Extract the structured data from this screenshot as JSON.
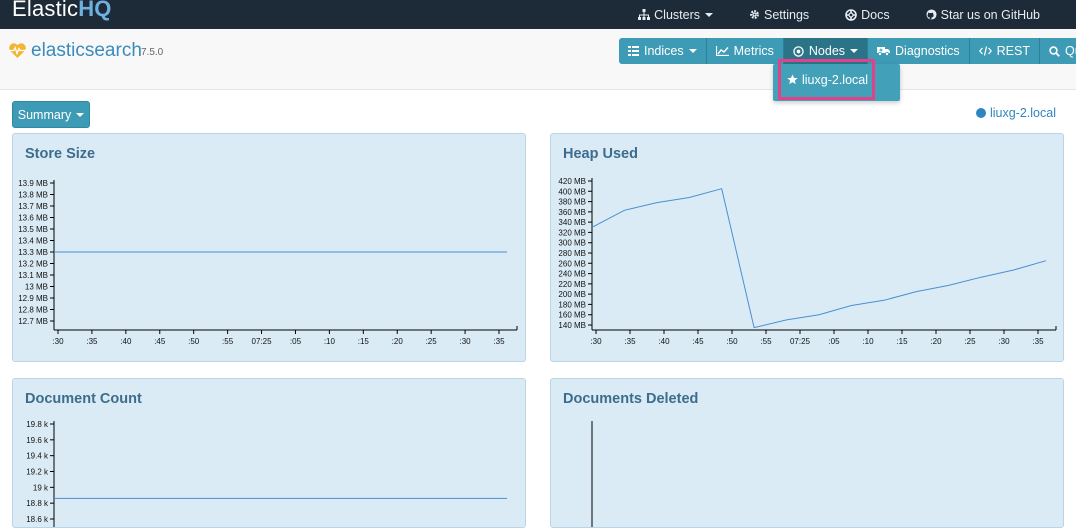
{
  "topbar": {
    "brand_main": "Elastic",
    "brand_accent": "HQ",
    "items": [
      {
        "label": "Clusters",
        "icon": "sitemap-icon",
        "dropdown": true
      },
      {
        "label": "Settings",
        "icon": "gear-icon",
        "dropdown": false
      },
      {
        "label": "Docs",
        "icon": "lifebuoy-icon",
        "dropdown": false
      },
      {
        "label": "Star us on GitHub",
        "icon": "github-icon",
        "dropdown": false
      }
    ]
  },
  "header": {
    "cluster_name": "elasticsearch",
    "version": "7.5.0",
    "buttons": [
      {
        "label": "Indices",
        "icon": "table-icon",
        "dropdown": true
      },
      {
        "label": "Metrics",
        "icon": "line-chart-icon",
        "dropdown": false
      },
      {
        "label": "Nodes",
        "icon": "target-icon",
        "dropdown": true
      },
      {
        "label": "Diagnostics",
        "icon": "ambulance-icon",
        "dropdown": false
      },
      {
        "label": "REST",
        "icon": "code-icon",
        "dropdown": false
      },
      {
        "label": "Query",
        "icon": "search-icon",
        "dropdown": false
      }
    ],
    "nodes_dropdown": [
      {
        "label": "liuxg-2.local",
        "icon": "star-icon"
      }
    ]
  },
  "summary": {
    "label": "Summary"
  },
  "node_status": {
    "label": "liuxg-2.local"
  },
  "colors": {
    "navbar": "#1d2a37",
    "button": "#3e9bb5",
    "panel": "#dbebf5",
    "line": "#4a8fd0",
    "highlight": "#e0418b"
  },
  "panels": {
    "store_size": {
      "title": "Store Size"
    },
    "heap_used": {
      "title": "Heap Used"
    },
    "document_count": {
      "title": "Document Count"
    },
    "documents_deleted": {
      "title": "Documents Deleted"
    }
  },
  "chart_data": [
    {
      "type": "line",
      "title": "Store Size",
      "yticks": [
        "13.9 MB",
        "13.8 MB",
        "13.7 MB",
        "13.6 MB",
        "13.5 MB",
        "13.4 MB",
        "13.3 MB",
        "13.2 MB",
        "13.1 MB",
        "13 MB",
        "12.9 MB",
        "12.8 MB",
        "12.7 MB"
      ],
      "ylim": [
        12.65,
        13.95
      ],
      "xticks": [
        ":30",
        ":35",
        ":40",
        ":45",
        ":50",
        ":55",
        "07:25",
        ":05",
        ":10",
        ":15",
        ":20",
        ":25",
        ":30",
        ":35"
      ],
      "x": [
        ":30",
        ":35",
        ":40",
        ":45",
        ":50",
        ":55",
        "07:25",
        ":05",
        ":10",
        ":15",
        ":20",
        ":25",
        ":30",
        ":35"
      ],
      "series": [
        {
          "values": [
            13.3,
            13.3,
            13.3,
            13.3,
            13.3,
            13.3,
            13.3,
            13.3,
            13.3,
            13.3,
            13.3,
            13.3,
            13.3,
            13.3
          ]
        }
      ]
    },
    {
      "type": "line",
      "title": "Heap Used",
      "yticks": [
        "420 MB",
        "400 MB",
        "380 MB",
        "360 MB",
        "340 MB",
        "320 MB",
        "300 MB",
        "280 MB",
        "260 MB",
        "240 MB",
        "220 MB",
        "200 MB",
        "180 MB",
        "160 MB",
        "140 MB"
      ],
      "ylim": [
        135,
        425
      ],
      "xticks": [
        ":30",
        ":35",
        ":40",
        ":45",
        ":50",
        ":55",
        "07:25",
        ":05",
        ":10",
        ":15",
        ":20",
        ":25",
        ":30",
        ":35"
      ],
      "x": [
        ":30",
        ":35",
        ":40",
        ":45",
        ":50",
        ":55",
        "07:25",
        ":05",
        ":10",
        ":15",
        ":20",
        ":25",
        ":30",
        ":35"
      ],
      "series": [
        {
          "values": [
            330,
            363,
            378,
            388,
            405,
            135,
            150,
            160,
            178,
            188,
            205,
            217,
            233,
            247,
            265
          ]
        }
      ]
    },
    {
      "type": "line",
      "title": "Document Count",
      "yticks": [
        "19.8 k",
        "19.6 k",
        "19.4 k",
        "19.2 k",
        "19 k",
        "18.8 k",
        "18.6 k"
      ],
      "ylim": [
        18.6,
        19.8
      ],
      "series": [
        {
          "values": [
            18.86,
            18.86,
            18.86,
            18.86,
            18.86,
            18.86,
            18.86,
            18.86,
            18.86,
            18.86,
            18.86,
            18.86,
            18.86,
            18.86
          ]
        }
      ]
    },
    {
      "type": "line",
      "title": "Documents Deleted",
      "series": []
    }
  ]
}
